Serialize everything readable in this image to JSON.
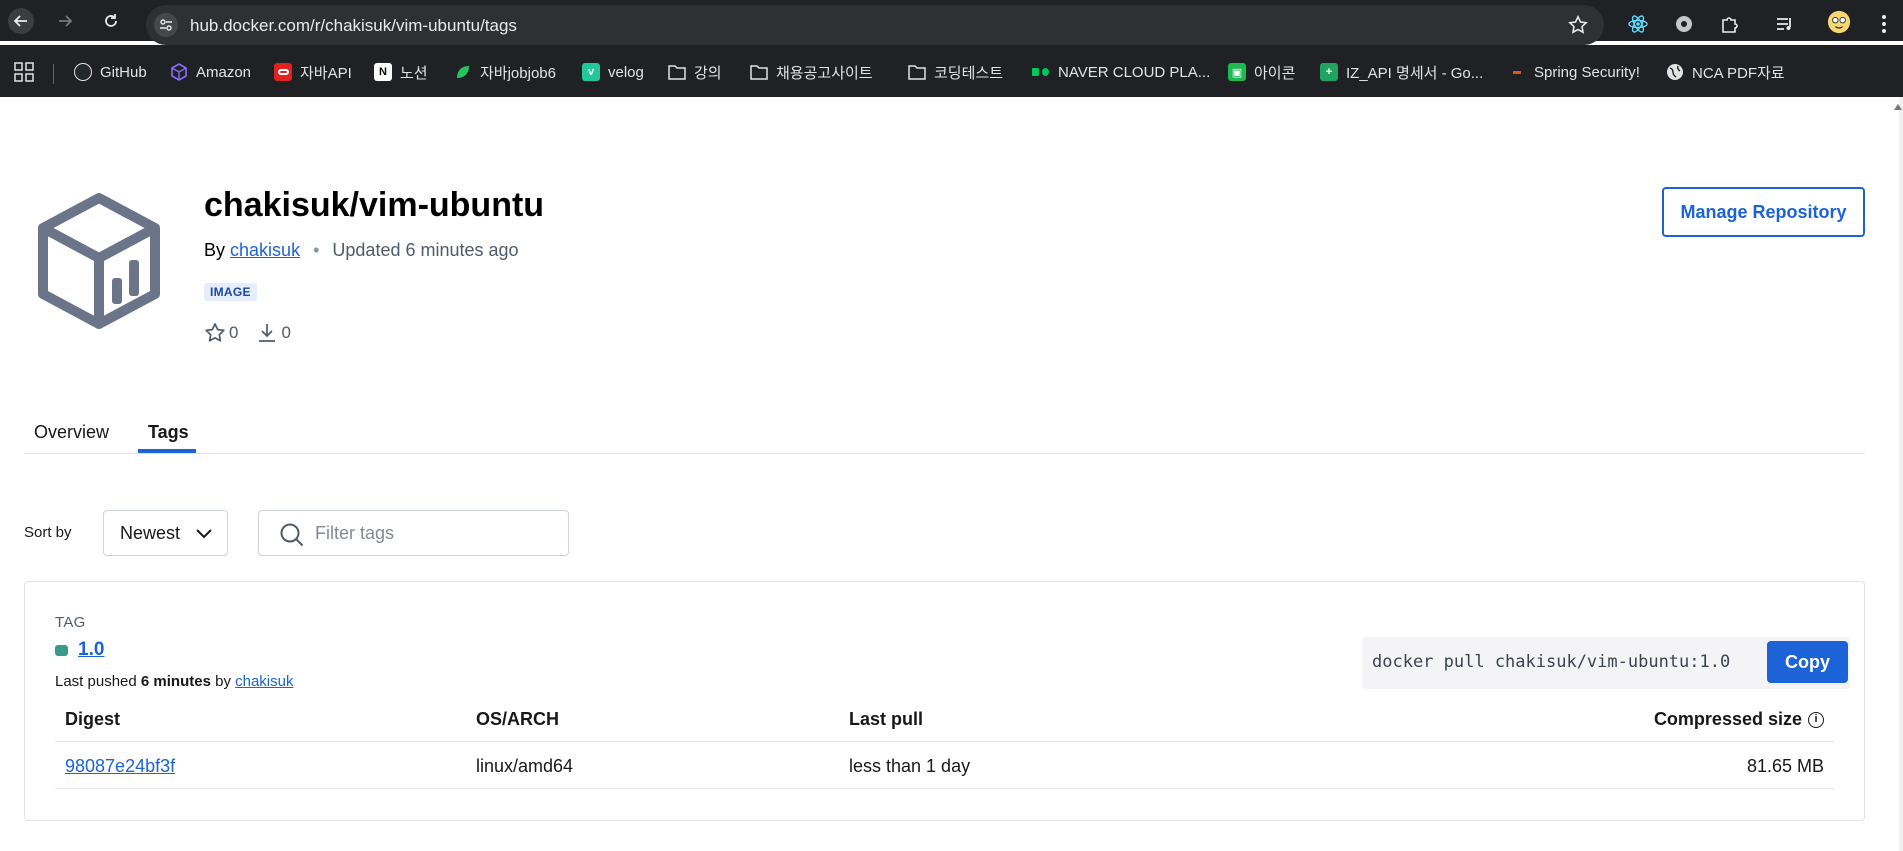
{
  "browser": {
    "url": "hub.docker.com/r/chakisuk/vim-ubuntu/tags",
    "bookmarks": [
      {
        "label": "GitHub",
        "icon": "github-icon",
        "color": "#24292e"
      },
      {
        "label": "Amazon",
        "icon": "amazon-icon",
        "color": "#7b5cff"
      },
      {
        "label": "자바API",
        "icon": "oracle-icon",
        "color": "#e0231f"
      },
      {
        "label": "노션",
        "icon": "notion-icon",
        "color": "#ffffff"
      },
      {
        "label": "자바jobjob6",
        "icon": "leaf-icon",
        "color": "#22c55e"
      },
      {
        "label": "velog",
        "icon": "velog-icon",
        "color": "#20c997"
      },
      {
        "label": "강의",
        "icon": "folder-icon",
        "color": "#e3e3e3"
      },
      {
        "label": "채용공고사이트",
        "icon": "folder-icon",
        "color": "#e3e3e3"
      },
      {
        "label": "코딩테스트",
        "icon": "folder-icon",
        "color": "#e3e3e3"
      },
      {
        "label": "NAVER CLOUD PLA...",
        "icon": "naver-cloud-icon",
        "color": "#03c75a"
      },
      {
        "label": "아이콘",
        "icon": "icon-site-icon",
        "color": "#1db954"
      },
      {
        "label": "IZ_API 명세서 - Go...",
        "icon": "sheets-icon",
        "color": "#1fa463"
      },
      {
        "label": "Spring Security!",
        "icon": "dash-icon",
        "color": "#e8521c"
      },
      {
        "label": "NCA PDF자료",
        "icon": "globe-icon",
        "color": "#e3e3e3"
      }
    ]
  },
  "repo": {
    "title": "chakisuk/vim-ubuntu",
    "by_label": "By",
    "owner": "chakisuk",
    "updated": "Updated 6 minutes ago",
    "badge": "IMAGE",
    "stars": "0",
    "pulls": "0",
    "manage_label": "Manage Repository"
  },
  "tabs": [
    {
      "label": "Overview",
      "active": false
    },
    {
      "label": "Tags",
      "active": true
    }
  ],
  "filters": {
    "sort_label": "Sort by",
    "sort_value": "Newest",
    "filter_placeholder": "Filter tags"
  },
  "tag": {
    "header": "TAG",
    "name": "1.0",
    "last_pushed_prefix": "Last pushed",
    "last_pushed_time": "6 minutes",
    "by": "by",
    "pusher": "chakisuk",
    "pull_command": "docker pull chakisuk/vim-ubuntu:1.0",
    "copy_label": "Copy",
    "columns": [
      "Digest",
      "OS/ARCH",
      "Last pull",
      "Compressed size"
    ],
    "rows": [
      {
        "digest": "98087e24bf3f",
        "os_arch": "linux/amd64",
        "last_pull": "less than 1 day",
        "size": "81.65 MB"
      }
    ]
  },
  "colors": {
    "accent": "#1b63d6",
    "chrome": "#1f2124",
    "tag_status": "#3a9a8a"
  }
}
